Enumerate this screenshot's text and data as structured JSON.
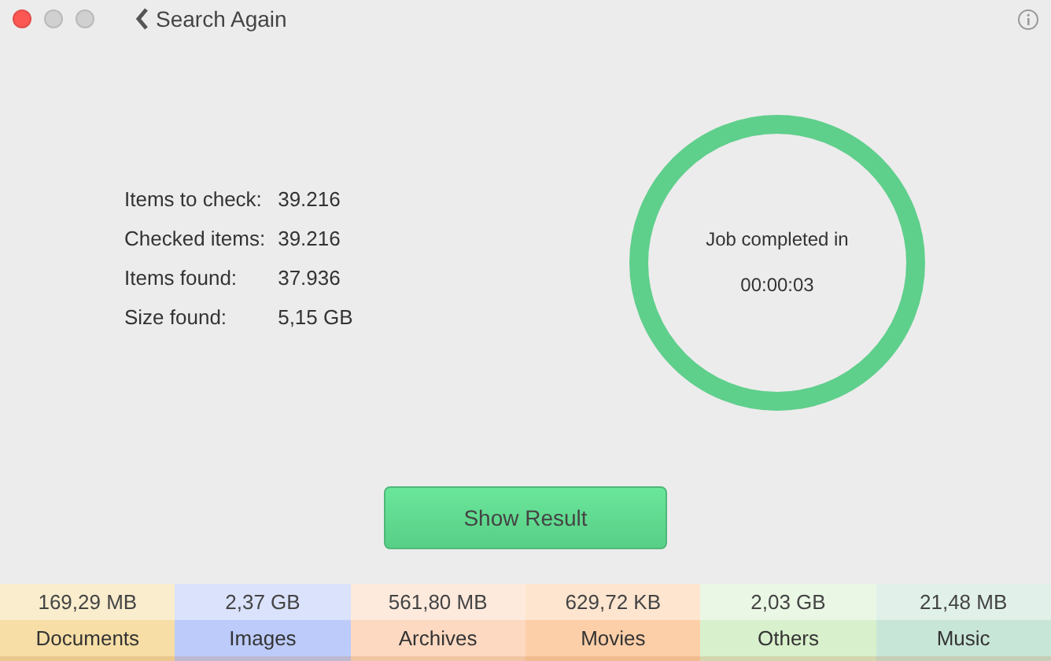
{
  "window": {
    "back_label": "Search Again"
  },
  "stats": [
    {
      "label": "Items to check:",
      "value": "39.216"
    },
    {
      "label": "Checked items:",
      "value": "39.216"
    },
    {
      "label": "Items found:",
      "value": "37.936"
    },
    {
      "label": "Size found:",
      "value": "5,15 GB"
    }
  ],
  "status": {
    "title": "Job completed in",
    "time": "00:00:03"
  },
  "button": "Show Result",
  "categories": [
    {
      "size": "169,29 MB",
      "name": "Documents",
      "color": "#f6dea6"
    },
    {
      "size": "2,37 GB",
      "name": "Images",
      "color": "#bccbf9"
    },
    {
      "size": "561,80 MB",
      "name": "Archives",
      "color": "#fdd9c1"
    },
    {
      "size": "629,72 KB",
      "name": "Movies",
      "color": "#fdcfa8"
    },
    {
      "size": "2,03 GB",
      "name": "Others",
      "color": "#d9f0cd"
    },
    {
      "size": "21,48 MB",
      "name": "Music",
      "color": "#c8e6d8"
    }
  ]
}
